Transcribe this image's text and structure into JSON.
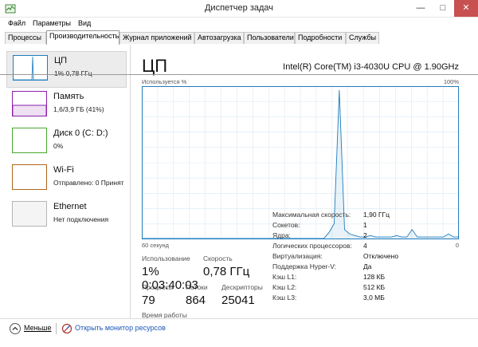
{
  "window": {
    "title": "Диспетчер задач"
  },
  "menu": [
    "Файл",
    "Параметры",
    "Вид"
  ],
  "tabs": [
    "Процессы",
    "Производительность",
    "Журнал приложений",
    "Автозагрузка",
    "Пользователи",
    "Подробности",
    "Службы"
  ],
  "sidebar": {
    "items": [
      {
        "name": "ЦП",
        "detail": "1% 0,78 ГГц",
        "color": "#1e7dbd"
      },
      {
        "name": "Память",
        "detail": "1,6/3,9 ГБ (41%)",
        "color": "#8b21a8"
      },
      {
        "name": "Диск 0 (C: D:)",
        "detail": "0%",
        "color": "#4aa72e"
      },
      {
        "name": "Wi-Fi",
        "detail": "Отправлено: 0 Принят",
        "color": "#b0661a"
      },
      {
        "name": "Ethernet",
        "detail": "Нет подключения",
        "color": "#9a9a9a"
      }
    ]
  },
  "main": {
    "title": "ЦП",
    "cpu_model": "Intel(R) Core(TM) i3-4030U CPU @ 1.90GHz",
    "chart_top_left": "Используется %",
    "chart_top_right": "100%",
    "chart_bottom_left": "60 секунд",
    "chart_bottom_right": "0",
    "stats": {
      "usage_label": "Использование",
      "usage_value": "1%",
      "speed_label": "Скорость",
      "speed_value": "0,78 ГГц",
      "processes_label": "Процессы",
      "processes_value": "79",
      "threads_label": "Потоки",
      "threads_value": "864",
      "handles_label": "Дескрипторы",
      "handles_value": "25041",
      "uptime_label": "Время работы",
      "uptime_value": "0:03:40:03"
    },
    "properties": [
      {
        "label": "Максимальная скорость:",
        "value": "1,90 ГГц"
      },
      {
        "label": "Сокетов:",
        "value": "1"
      },
      {
        "label": "Ядра:",
        "value": "2"
      },
      {
        "label": "Логических процессоров:",
        "value": "4"
      },
      {
        "label": "Виртуализация:",
        "value": "Отключено"
      },
      {
        "label": "Поддержка Hyper-V:",
        "value": "Да"
      },
      {
        "label": "Кэш L1:",
        "value": "128 КБ"
      },
      {
        "label": "Кэш L2:",
        "value": "512 КБ"
      },
      {
        "label": "Кэш L3:",
        "value": "3,0 МБ"
      }
    ]
  },
  "footer": {
    "less_label": "Меньше",
    "monitor_label": "Открыть монитор ресурсов"
  },
  "chart_data": {
    "type": "area",
    "ylim": [
      0,
      100
    ],
    "xlim": [
      60,
      0
    ],
    "values": [
      0,
      0,
      0,
      0,
      0,
      0,
      0,
      0,
      0,
      0,
      0,
      0,
      0,
      0,
      0,
      0,
      0,
      0,
      0,
      0,
      0,
      0,
      0,
      0,
      0,
      0,
      0,
      0,
      0,
      0,
      0,
      0,
      0,
      0,
      0,
      0,
      4,
      10,
      100,
      6,
      3,
      2,
      1,
      1,
      2,
      1,
      1,
      1,
      1,
      2,
      1,
      1,
      6,
      1,
      1,
      1,
      1,
      1,
      1,
      3,
      1,
      1
    ]
  }
}
